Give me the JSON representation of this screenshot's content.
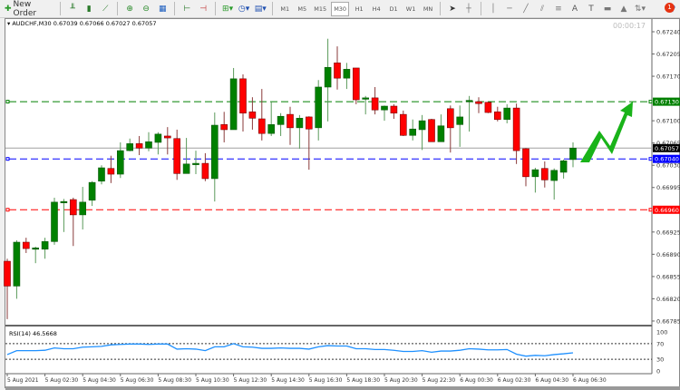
{
  "toolbar": {
    "new_order": "New Order",
    "timeframes": [
      "M1",
      "M5",
      "M15",
      "M30",
      "H1",
      "H4",
      "D1",
      "W1",
      "MN"
    ],
    "active_timeframe": "M30",
    "notifications": "1",
    "icons": [
      "bar-chart-icon",
      "candlestick-icon",
      "line-chart-icon",
      "zoom-in-icon",
      "zoom-out-icon",
      "tile-windows-icon",
      "auto-scroll-icon",
      "chart-shift-icon",
      "indicators-icon",
      "periods-icon",
      "templates-icon",
      "cursor-icon",
      "crosshair-icon",
      "vertical-line-icon",
      "horizontal-line-icon",
      "trendline-icon",
      "fibonacci-icon",
      "equidistant-channel-icon",
      "text-icon",
      "text-label-icon",
      "rectangle-icon",
      "triangle-icon",
      "arrows-icon",
      "search-icon"
    ]
  },
  "chart": {
    "symbol": "AUDCHF,M30",
    "open": "0.67039",
    "high": "0.67066",
    "low": "0.67027",
    "close": "0.67057",
    "timer": "00:00:17",
    "price_ticks": [
      "0.67240",
      "0.67205",
      "0.67170",
      "0.67100",
      "0.67065",
      "0.67030",
      "0.66995",
      "0.66925",
      "0.66890",
      "0.66855",
      "0.66820",
      "0.66785"
    ],
    "levels": [
      {
        "price": "0.67130",
        "color": "#008000"
      },
      {
        "price": "0.67040",
        "color": "#0000ff"
      },
      {
        "price": "0.66960",
        "color": "#ff0000"
      }
    ],
    "bid": {
      "price": "0.67057",
      "color": "#000000"
    },
    "bull_color": "#008000",
    "bear_color": "#ff0000",
    "time_labels": [
      "5 Aug 2021",
      "5 Aug 02:30",
      "5 Aug 04:30",
      "5 Aug 06:30",
      "5 Aug 08:30",
      "5 Aug 10:30",
      "5 Aug 12:30",
      "5 Aug 14:30",
      "5 Aug 16:30",
      "5 Aug 18:30",
      "5 Aug 20:30",
      "5 Aug 22:30",
      "6 Aug 00:30",
      "6 Aug 02:30",
      "6 Aug 04:30",
      "6 Aug 06:30"
    ],
    "ohlc": [
      [
        0.66879,
        0.66883,
        0.66788,
        0.6684
      ],
      [
        0.6684,
        0.66912,
        0.6682,
        0.66909
      ],
      [
        0.66909,
        0.66916,
        0.66892,
        0.66899
      ],
      [
        0.66899,
        0.66902,
        0.66876,
        0.669
      ],
      [
        0.66898,
        0.66916,
        0.66883,
        0.6691
      ],
      [
        0.6691,
        0.66979,
        0.66905,
        0.66972
      ],
      [
        0.66973,
        0.66977,
        0.66925,
        0.66973
      ],
      [
        0.66976,
        0.66979,
        0.66903,
        0.66952
      ],
      [
        0.66952,
        0.66996,
        0.66929,
        0.66972
      ],
      [
        0.66975,
        0.67005,
        0.66966,
        0.67003
      ],
      [
        0.67005,
        0.6703,
        0.67,
        0.67026
      ],
      [
        0.67025,
        0.67045,
        0.67002,
        0.67016
      ],
      [
        0.67016,
        0.67066,
        0.6701,
        0.67053
      ],
      [
        0.67053,
        0.67072,
        0.67052,
        0.67064
      ],
      [
        0.67064,
        0.67076,
        0.67046,
        0.67057
      ],
      [
        0.67057,
        0.67082,
        0.67052,
        0.67067
      ],
      [
        0.67066,
        0.67082,
        0.67047,
        0.67079
      ],
      [
        0.67076,
        0.6709,
        0.67047,
        0.67073
      ],
      [
        0.67072,
        0.67086,
        0.67007,
        0.67017
      ],
      [
        0.67017,
        0.67073,
        0.67017,
        0.67032
      ],
      [
        0.67032,
        0.67053,
        0.67016,
        0.67033
      ],
      [
        0.67033,
        0.67049,
        0.67005,
        0.67009
      ],
      [
        0.67009,
        0.67113,
        0.66973,
        0.67093
      ],
      [
        0.67094,
        0.67114,
        0.67066,
        0.67086
      ],
      [
        0.67086,
        0.67183,
        0.67086,
        0.67166
      ],
      [
        0.67166,
        0.67173,
        0.67083,
        0.67112
      ],
      [
        0.67114,
        0.67137,
        0.67086,
        0.67104
      ],
      [
        0.67103,
        0.6715,
        0.67069,
        0.6708
      ],
      [
        0.6708,
        0.6713,
        0.67076,
        0.67094
      ],
      [
        0.67094,
        0.67112,
        0.67076,
        0.67107
      ],
      [
        0.6711,
        0.67122,
        0.67062,
        0.67089
      ],
      [
        0.67089,
        0.67109,
        0.67056,
        0.67104
      ],
      [
        0.67106,
        0.67107,
        0.67023,
        0.67087
      ],
      [
        0.67089,
        0.67164,
        0.67069,
        0.67153
      ],
      [
        0.67153,
        0.67229,
        0.67099,
        0.67184
      ],
      [
        0.67191,
        0.67217,
        0.67149,
        0.67167
      ],
      [
        0.67167,
        0.67191,
        0.6715,
        0.67181
      ],
      [
        0.67183,
        0.67183,
        0.67126,
        0.67133
      ],
      [
        0.67134,
        0.67139,
        0.6711,
        0.67136
      ],
      [
        0.67136,
        0.67153,
        0.6711,
        0.67117
      ],
      [
        0.67117,
        0.67124,
        0.671,
        0.67123
      ],
      [
        0.67123,
        0.67126,
        0.67103,
        0.67112
      ],
      [
        0.6711,
        0.67116,
        0.67076,
        0.67077
      ],
      [
        0.67077,
        0.67102,
        0.67069,
        0.67087
      ],
      [
        0.67086,
        0.67109,
        0.67054,
        0.671
      ],
      [
        0.67102,
        0.67103,
        0.67067,
        0.67067
      ],
      [
        0.67067,
        0.6711,
        0.67067,
        0.67092
      ],
      [
        0.67119,
        0.67124,
        0.6705,
        0.67089
      ],
      [
        0.67094,
        0.67124,
        0.67059,
        0.67106
      ],
      [
        0.6713,
        0.67139,
        0.67083,
        0.67132
      ],
      [
        0.6713,
        0.67137,
        0.67112,
        0.67127
      ],
      [
        0.67129,
        0.6713,
        0.67112,
        0.67113
      ],
      [
        0.67114,
        0.67122,
        0.67099,
        0.67102
      ],
      [
        0.67102,
        0.67126,
        0.67096,
        0.6712
      ],
      [
        0.6712,
        0.67127,
        0.67032,
        0.67053
      ],
      [
        0.67056,
        0.67057,
        0.66997,
        0.67012
      ],
      [
        0.67012,
        0.67026,
        0.66987,
        0.67023
      ],
      [
        0.67025,
        0.67036,
        0.66995,
        0.67007
      ],
      [
        0.67006,
        0.67025,
        0.66976,
        0.67022
      ],
      [
        0.67019,
        0.67039,
        0.67009,
        0.67037
      ],
      [
        0.67039,
        0.67066,
        0.67027,
        0.67057
      ]
    ]
  },
  "rsi": {
    "label": "RSI(14) 46.5668",
    "ticks": [
      "100",
      "70",
      "30",
      "0"
    ],
    "levels": [
      70,
      30
    ],
    "color": "#1e90ff",
    "values": [
      42,
      52,
      52,
      52,
      53,
      59,
      57,
      57,
      61,
      62,
      63,
      67,
      68,
      69,
      69,
      68,
      69,
      69,
      56,
      57,
      56,
      52,
      62,
      62,
      70,
      62,
      61,
      58,
      58,
      59,
      58,
      58,
      56,
      62,
      65,
      64,
      64,
      57,
      57,
      55,
      55,
      53,
      50,
      50,
      52,
      48,
      51,
      51,
      53,
      57,
      56,
      54,
      54,
      55,
      43,
      38,
      40,
      39,
      42,
      44,
      46.57
    ]
  },
  "arrow_color": "#19b319"
}
